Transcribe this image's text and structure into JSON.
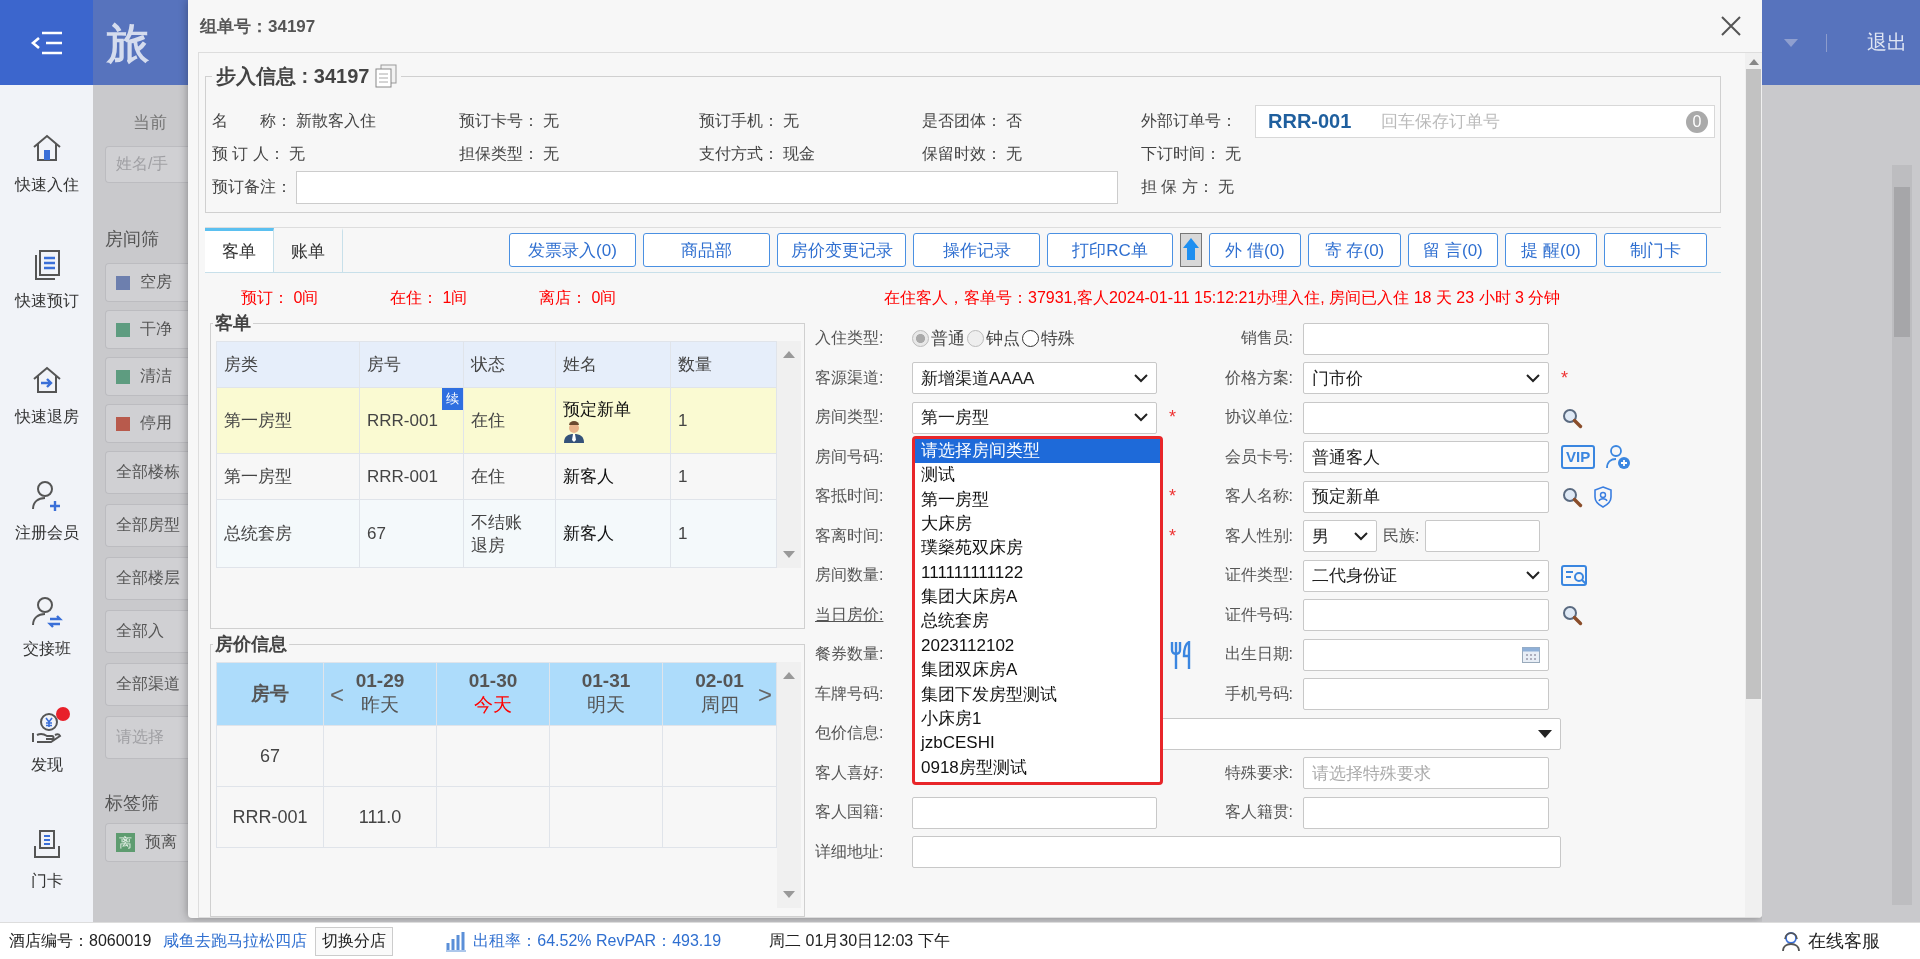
{
  "sidebar": {
    "items": [
      {
        "label": "快速入住",
        "notification": false
      },
      {
        "label": "快速预订",
        "notification": false
      },
      {
        "label": "快速退房",
        "notification": false
      },
      {
        "label": "注册会员",
        "notification": false
      },
      {
        "label": "交接班",
        "notification": false
      },
      {
        "label": "发现",
        "notification": true
      },
      {
        "label": "门卡",
        "notification": false
      }
    ]
  },
  "background": {
    "title_fragment": "旅",
    "current_fragment": "当前",
    "search_placeholder": "姓名/手",
    "room_filter_title": "房间筛",
    "room_filters": [
      {
        "label": "空房",
        "color": "#6d7fae"
      },
      {
        "label": "干净",
        "color": "#5e9c80"
      },
      {
        "label": "清洁",
        "color": "#5e9c80"
      },
      {
        "label": "停用",
        "color": "#b85a4c"
      }
    ],
    "selects": [
      "全部楼栋",
      "全部房型",
      "全部楼层",
      "全部入",
      "全部渠道"
    ],
    "feature_placeholder": "请选择",
    "tag_filter_title": "标签筛",
    "tags": [
      {
        "badge": "离",
        "label": "预离"
      }
    ],
    "logout": "退出"
  },
  "dialog": {
    "title": "组单号：34197",
    "walkin": {
      "heading": "步入信息 : 34197",
      "rows": [
        [
          {
            "kind": "text",
            "label": "名　　称：",
            "value": "新散客入住"
          },
          {
            "kind": "text",
            "label": "预订卡号：",
            "value": "无"
          },
          {
            "kind": "text",
            "label": "预订手机：",
            "value": "无"
          },
          {
            "kind": "text",
            "label": "是否团体：",
            "value": "否"
          },
          {
            "kind": "order_field",
            "label": "外部订单号：",
            "value": "RRR-001",
            "placeholder": "回车保存订单号",
            "count": "0"
          }
        ],
        [
          {
            "kind": "text",
            "label": "预 订 人：",
            "value": "无"
          },
          {
            "kind": "text",
            "label": "担保类型：",
            "value": "无"
          },
          {
            "kind": "text",
            "label": "支付方式：",
            "value": "现金"
          },
          {
            "kind": "text",
            "label": "保留时效：",
            "value": "无"
          },
          {
            "kind": "text",
            "label": "下订时间：",
            "value": "无"
          }
        ],
        [
          {
            "kind": "remark_field",
            "label": "预订备注：",
            "colspan": 4
          },
          {
            "kind": "text",
            "label": "担 保 方：",
            "value": "无"
          }
        ]
      ]
    },
    "tabs": [
      {
        "label": "客单",
        "selected": true
      },
      {
        "label": "账单",
        "selected": false
      }
    ],
    "toolbar": [
      {
        "kind": "button",
        "label": "发票录入(0)"
      },
      {
        "kind": "button",
        "label": "商品部"
      },
      {
        "kind": "button",
        "label": "房价变更记录"
      },
      {
        "kind": "button",
        "label": "操作记录"
      },
      {
        "kind": "button",
        "label": "打印RC单"
      },
      {
        "kind": "upload_icon"
      },
      {
        "kind": "button",
        "label": "外 借(0)"
      },
      {
        "kind": "button",
        "label": "寄 存(0)"
      },
      {
        "kind": "button",
        "label": "留 言(0)"
      },
      {
        "kind": "button",
        "label": "提 醒(0)"
      },
      {
        "kind": "button",
        "label": "制门卡"
      }
    ],
    "summary": {
      "counts": [
        "预订： 0间",
        "在住： 1间",
        "离店： 0间"
      ],
      "status_text": "在住客人，客单号：37931,客人2024-01-11 15:12:21办理入住, 房间已入住 18 天 23 小时 3 分钟"
    },
    "guest_list": {
      "title": "客单",
      "columns": [
        "房类",
        "房号",
        "状态",
        "姓名",
        "数量"
      ],
      "rows": [
        {
          "selected": true,
          "badge": "续",
          "avatar": true,
          "cells": [
            "第一房型",
            "RRR-001",
            "在住",
            "预定新单",
            "1"
          ]
        },
        {
          "selected": false,
          "avatar": false,
          "cells": [
            "第一房型",
            "RRR-001",
            "在住",
            "新客人",
            "1"
          ]
        },
        {
          "selected": false,
          "avatar": false,
          "cells": [
            "总统套房",
            "67",
            "不结账退房",
            "新客人",
            "1"
          ]
        }
      ]
    },
    "rate_info": {
      "title": "房价信息",
      "room_header": "房号",
      "prev": "<",
      "next": ">",
      "days": [
        {
          "date": "01-29",
          "label": "昨天",
          "today": false
        },
        {
          "date": "01-30",
          "label": "今天",
          "today": true
        },
        {
          "date": "01-31",
          "label": "明天",
          "today": false
        },
        {
          "date": "02-01",
          "label": "周四",
          "today": false
        }
      ],
      "rows": [
        {
          "room": "67"
        },
        {
          "room": "RRR-001",
          "rates": [
            "111.0"
          ]
        }
      ]
    },
    "form": {
      "rows": [
        {
          "left": {
            "label": "入住类型:",
            "kind": "radio",
            "options": [
              {
                "label": "普通",
                "selected": true,
                "disabled": true
              },
              {
                "label": "钟点",
                "selected": false,
                "disabled": true
              },
              {
                "label": "特殊",
                "selected": false,
                "disabled": false
              }
            ]
          },
          "right": {
            "label": "销售员:",
            "kind": "input"
          }
        },
        {
          "left": {
            "label": "客源渠道:",
            "kind": "select",
            "value": "新增渠道AAAA"
          },
          "right": {
            "label": "价格方案:",
            "kind": "select",
            "value": "门市价",
            "required_mark": "*"
          }
        },
        {
          "left": {
            "label": "房间类型:",
            "kind": "select",
            "value": "第一房型",
            "required_mark": "*",
            "dropdown": true
          },
          "right": {
            "label": "协议单位:",
            "kind": "input",
            "icons": [
              {
                "kind": "search"
              }
            ]
          }
        },
        {
          "left": {
            "label": "房间号码:",
            "kind": "covered"
          },
          "right": {
            "label": "会员卡号:",
            "kind": "input",
            "value": "普通客人",
            "icons": [
              {
                "kind": "vip",
                "text": "VIP"
              },
              {
                "kind": "user_add"
              }
            ]
          }
        },
        {
          "left": {
            "label": "客抵时间:",
            "kind": "covered",
            "required_mark": "*"
          },
          "right": {
            "label": "客人名称:",
            "kind": "input",
            "value": "预定新单",
            "icons": [
              {
                "kind": "search"
              },
              {
                "kind": "shield"
              }
            ]
          }
        },
        {
          "left": {
            "label": "客离时间:",
            "kind": "covered",
            "required_mark": "*"
          },
          "right": {
            "label": "客人性别:",
            "kind": "gender",
            "value": "男",
            "extra_label": "民族:"
          }
        },
        {
          "left": {
            "label": "房间数量:",
            "kind": "covered"
          },
          "right": {
            "label": "证件类型:",
            "kind": "select",
            "value": "二代身份证",
            "icons": [
              {
                "kind": "id_search"
              }
            ]
          }
        },
        {
          "left": {
            "label": "当日房价:",
            "kind": "covered",
            "link": true
          },
          "right": {
            "label": "证件号码:",
            "kind": "input",
            "icons": [
              {
                "kind": "search"
              }
            ]
          }
        },
        {
          "left": {
            "label": "餐券数量:",
            "kind": "covered",
            "icons": [
              {
                "kind": "meal"
              }
            ]
          },
          "right": {
            "label": "出生日期:",
            "kind": "date"
          }
        },
        {
          "left": {
            "label": "车牌号码:",
            "kind": "covered"
          },
          "right": {
            "label": "手机号码:",
            "kind": "input"
          }
        },
        {
          "left": {
            "label": "包价信息:",
            "kind": "wide_select"
          }
        },
        {
          "left": {
            "label": "客人喜好:",
            "kind": "covered"
          },
          "right": {
            "label": "特殊要求:",
            "kind": "input",
            "placeholder": "请选择特殊要求"
          }
        },
        {
          "left": {
            "label": "客人国籍:",
            "kind": "input"
          },
          "right": {
            "label": "客人籍贯:",
            "kind": "input"
          }
        },
        {
          "left": {
            "label": "详细地址:",
            "kind": "wide_input"
          }
        }
      ]
    },
    "room_type_dropdown": {
      "options": [
        {
          "label": "请选择房间类型",
          "selected": true
        },
        {
          "label": "测试",
          "selected": false
        },
        {
          "label": "第一房型",
          "selected": false
        },
        {
          "label": "大床房",
          "selected": false
        },
        {
          "label": "璞燊苑双床房",
          "selected": false
        },
        {
          "label": "111111111122",
          "selected": false
        },
        {
          "label": "集团大床房A",
          "selected": false
        },
        {
          "label": "总统套房",
          "selected": false
        },
        {
          "label": "2023112102",
          "selected": false
        },
        {
          "label": "集团双床房A",
          "selected": false
        },
        {
          "label": "集团下发房型测试",
          "selected": false
        },
        {
          "label": "小床房1",
          "selected": false
        },
        {
          "label": "jzbCESHI",
          "selected": false
        },
        {
          "label": "0918房型测试",
          "selected": false
        }
      ]
    }
  },
  "status_bar": {
    "hotel_id": "酒店编号：8060019",
    "store_link": "咸鱼去跑马拉松四店",
    "switch_button": "切换分店",
    "occupancy": "出租率：64.52% RevPAR：493.19",
    "datetime": "周二 01月30日12:03 下午",
    "support": "在线客服"
  }
}
